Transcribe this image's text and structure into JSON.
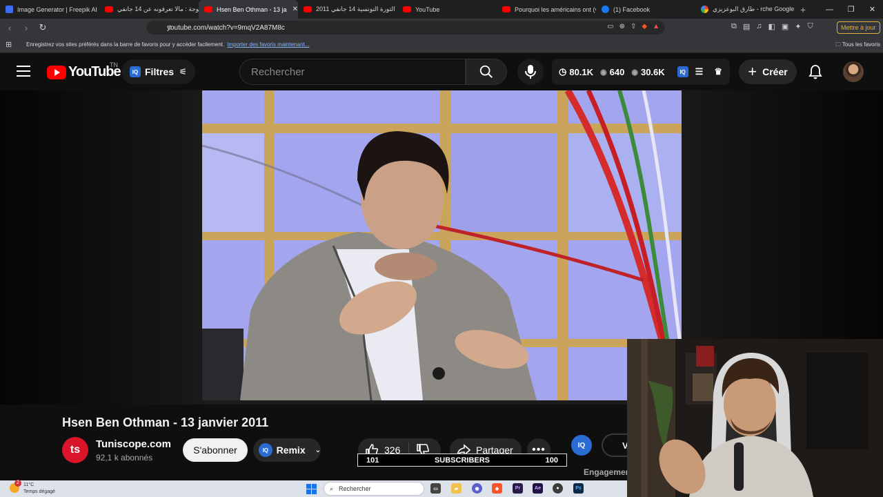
{
  "browser": {
    "tabs": [
      {
        "title": "Image Generator | Freepik AI",
        "icon": "freepik-favicon"
      },
      {
        "title": "بالحوجة : مالا تعرفونه عن 14 جانفي",
        "icon": "youtube-favicon"
      },
      {
        "title": "Hsen Ben Othman - 13 ja",
        "icon": "youtube-favicon",
        "active": true
      },
      {
        "title": "الثورة التونسية 14 جانفي 2011",
        "icon": "youtube-favicon"
      },
      {
        "title": "YouTube",
        "icon": "youtube-favicon"
      },
      {
        "title": "Pourquoi les américains ont (v",
        "icon": "youtube-favicon"
      },
      {
        "title": "(1) Facebook",
        "icon": "facebook-favicon"
      },
      {
        "title": "طارق البوعزيزي - rche Google",
        "icon": "google-favicon"
      }
    ],
    "url": "youtube.com/watch?v=9mqV2A87M8c",
    "update_button": "Mettre à jour",
    "bookmarks_prompt": "Enregistrez vos sites préférés dans la barre de favoris pour y accéder facilement.",
    "bookmarks_link": "Importer des favoris maintenant...",
    "all_bookmarks": "Tous les favoris"
  },
  "youtube": {
    "logo_text": "YouTube",
    "country_code": "TN",
    "filters_label": "Filtres",
    "iq_label": "IQ",
    "search_placeholder": "Rechercher",
    "stats": {
      "watch_hours": "80.1K",
      "views_short": "640",
      "views": "30.6K"
    },
    "create_label": "Créer"
  },
  "video": {
    "title": "Hsen Ben Othman - 13 janvier 2011",
    "channel_initials": "ts",
    "channel_name": "Tuniscope.com",
    "channel_subs": "92,1 k abonnés",
    "subscribe_label": "S'abonner",
    "remix_label": "Remix",
    "like_count": "326",
    "share_label": "Partager",
    "partial_button": "V",
    "engagement_label": "Engagement"
  },
  "subscriber_bar": {
    "left": "101",
    "label": "SUBSCRIBERS",
    "right": "100"
  },
  "taskbar": {
    "weather_temp": "11°C",
    "weather_desc": "Temps dégagé",
    "notification_count": "2",
    "search_placeholder": "Rechercher",
    "apps": [
      "Pr",
      "Ae",
      "Ps"
    ]
  }
}
